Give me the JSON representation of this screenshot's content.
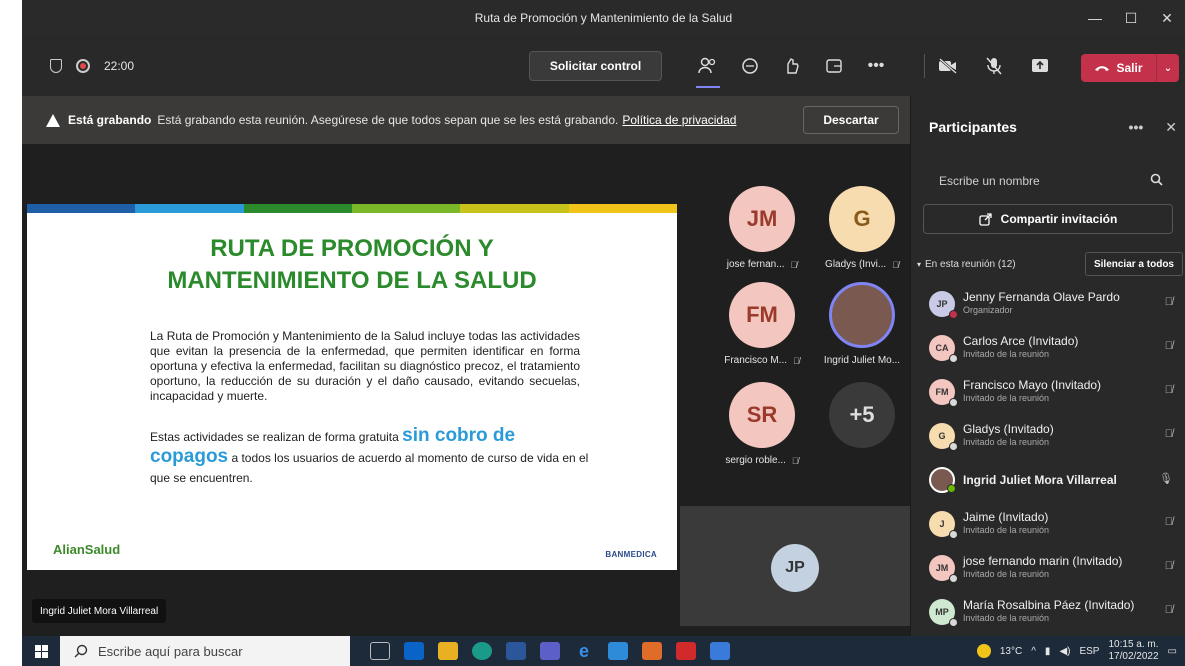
{
  "window": {
    "title": "Ruta de Promoción y Mantenimiento de la Salud",
    "controls": [
      "—",
      "☐",
      "✕"
    ]
  },
  "toolbar": {
    "timer": "22:00",
    "request_control": "Solicitar control",
    "leave_label": "Salir"
  },
  "banner": {
    "bold": "Está grabando",
    "text": "Está grabando esta reunión. Asegúrese de que todos sepan que se les está grabando.",
    "link": "Política de privacidad",
    "dismiss": "Descartar"
  },
  "slide": {
    "stripe_colors": [
      "#1f5fa8",
      "#2a9bd8",
      "#2b8a2b",
      "#7ab82a",
      "#c9c21a",
      "#f0c419"
    ],
    "title_line1": "RUTA DE PROMOCIÓN Y",
    "title_line2": "MANTENIMIENTO DE LA SALUD",
    "paragraph": "La Ruta de Promoción y Mantenimiento de la Salud incluye todas las actividades que evitan la presencia de la enfermedad, que permiten identificar en forma oportuna y efectiva la enfermedad, facilitan su diagnóstico precoz, el tratamiento oportuno, la reducción de su duración y el daño causado, evitando secuelas, incapacidad y muerte.",
    "p2_before": "Estas actividades se realizan de forma gratuita",
    "p2_highlight1": "sin cobro de",
    "p2_highlight2": "copagos",
    "p2_after": "a todos los usuarios de acuerdo al momento de curso de vida en el que se encuentren.",
    "logo_left": "AlianSalud",
    "logo_right": "BANMEDICA"
  },
  "presenter_name": "Ingrid Juliet Mora Villarreal",
  "tiles": [
    {
      "initials": "JM",
      "name": "jose fernan...",
      "bg": "#f4c6c0",
      "fg": "#9a3a2a"
    },
    {
      "initials": "G",
      "name": "Gladys (Invi...",
      "bg": "#f6dcae",
      "fg": "#8a5a1a"
    },
    {
      "initials": "FM",
      "name": "Francisco M...",
      "bg": "#f4c6c0",
      "fg": "#9a3a2a"
    },
    {
      "initials": "",
      "name": "Ingrid Juliet Mo...",
      "bg": "#7a5a50",
      "fg": "#fff"
    },
    {
      "initials": "SR",
      "name": "sergio roble...",
      "bg": "#f4c6c0",
      "fg": "#9a3a2a"
    },
    {
      "initials": "+5",
      "name": "",
      "bg": "#3a3a3a",
      "fg": "#ddd"
    }
  ],
  "jp_tile": {
    "initials": "JP"
  },
  "panel": {
    "title": "Participantes",
    "search_placeholder": "Escribe un nombre",
    "share": "Compartir invitación",
    "in_meeting": "En esta reunión (12)",
    "mute_all": "Silenciar a todos",
    "participants": [
      {
        "initials": "JP",
        "name": "Jenny Fernanda Olave Pardo",
        "role": "Organizador",
        "bg": "#c9cbe6",
        "status": "#c4314b"
      },
      {
        "initials": "CA",
        "name": "Carlos Arce (Invitado)",
        "role": "Invitado de la reunión",
        "bg": "#f4c6c0",
        "status": "#d9d9d9"
      },
      {
        "initials": "FM",
        "name": "Francisco Mayo (Invitado)",
        "role": "Invitado de la reunión",
        "bg": "#f4c6c0",
        "status": "#d9d9d9"
      },
      {
        "initials": "G",
        "name": "Gladys (Invitado)",
        "role": "Invitado de la reunión",
        "bg": "#f6dcae",
        "status": "#d9d9d9"
      },
      {
        "initials": "",
        "name": "Ingrid Juliet Mora Villarreal",
        "role": "",
        "bg": "#7a5a50",
        "status": "#6bb700"
      },
      {
        "initials": "J",
        "name": "Jaime (Invitado)",
        "role": "Invitado de la reunión",
        "bg": "#f6dcae",
        "status": "#d9d9d9"
      },
      {
        "initials": "JM",
        "name": "jose fernando marin (Invitado)",
        "role": "Invitado de la reunión",
        "bg": "#f4c6c0",
        "status": "#d9d9d9"
      },
      {
        "initials": "MP",
        "name": "María Rosalbina Páez (Invitado)",
        "role": "Invitado de la reunión",
        "bg": "#cfe8d0",
        "status": "#d9d9d9"
      }
    ]
  },
  "taskbar": {
    "search_placeholder": "Escribe aquí para buscar",
    "weather": "13°C",
    "lang": "ESP",
    "time": "10:15 a. m.",
    "date": "17/02/2022"
  }
}
